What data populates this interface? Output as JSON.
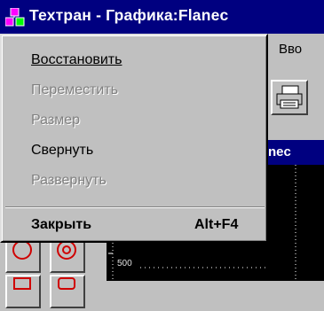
{
  "window": {
    "title": "Техтран - Графика:Flanec"
  },
  "menubar": {
    "partial_item": "Вво"
  },
  "child_window": {
    "title_partial": "nec"
  },
  "canvas": {
    "axis_label": "500"
  },
  "system_menu": {
    "items": [
      {
        "label": "Восстановить",
        "enabled": true
      },
      {
        "label": "Переместить",
        "enabled": false
      },
      {
        "label": "Размер",
        "enabled": false
      },
      {
        "label": "Свернуть",
        "enabled": true
      },
      {
        "label": "Развернуть",
        "enabled": false
      },
      {
        "label": "Закрыть",
        "shortcut": "Alt+F4",
        "enabled": true,
        "bold": true
      }
    ]
  },
  "colors": {
    "titlebar": "#000080",
    "face": "#c0c0c0",
    "canvas": "#000000",
    "icon_red": "#d00000"
  }
}
